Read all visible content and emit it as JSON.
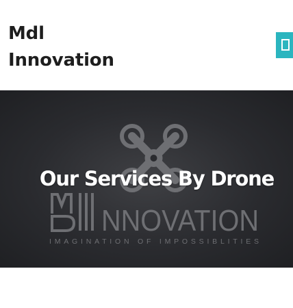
{
  "header": {
    "title_line1": "Mdl",
    "title_line2": "Innovation",
    "menu_icon": "menu-toggle-icon"
  },
  "hero": {
    "heading": "Our Services By Drone",
    "logo": {
      "wordmark": "NNOVATION",
      "tagline": "IMAGINATION OF IMPOSSIBLITIES"
    }
  },
  "colors": {
    "accent": "#2bb5bf",
    "title_text": "#1e1e1e",
    "hero_bg": "#2a2b2f",
    "logo_gray": "#6e6f73"
  }
}
